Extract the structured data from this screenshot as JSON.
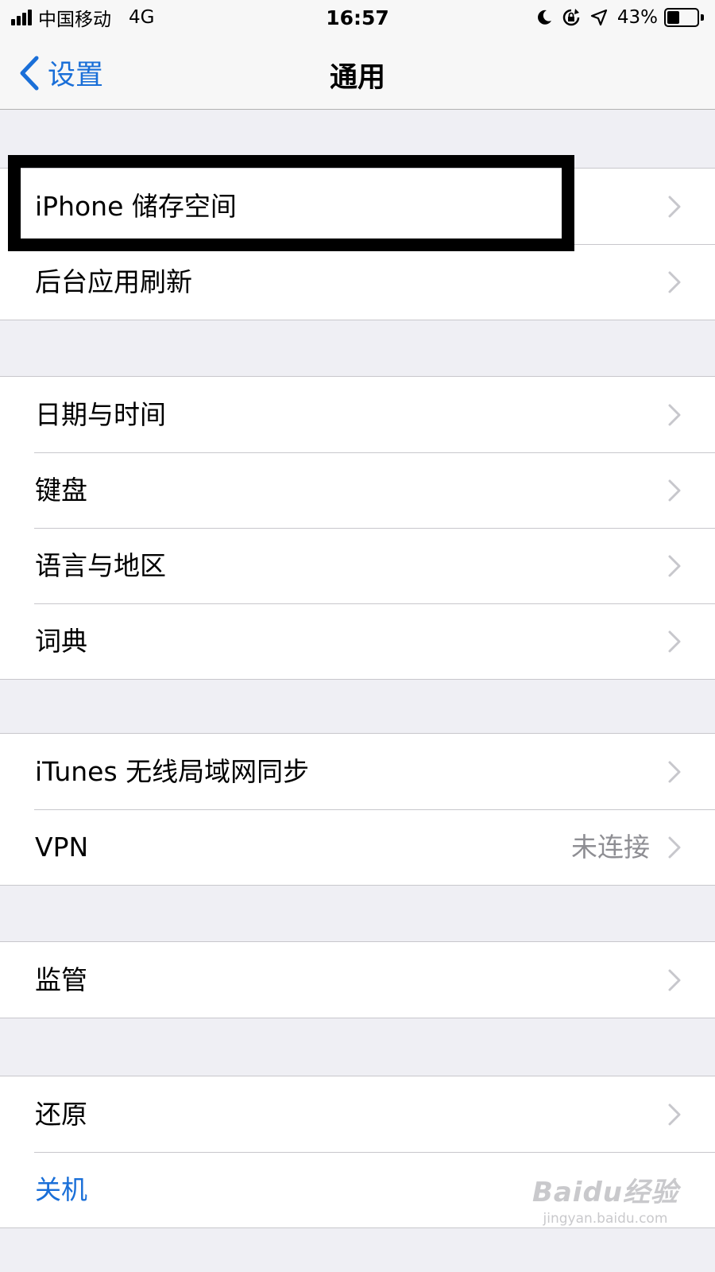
{
  "status_bar": {
    "carrier": "中国移动",
    "network": "4G",
    "time": "16:57",
    "battery_percent": "43%",
    "battery_level": 0.43,
    "icons": [
      "signal-icon",
      "moon-icon",
      "rotation-lock-icon",
      "location-icon",
      "battery-icon"
    ]
  },
  "nav": {
    "back_label": "设置",
    "title": "通用"
  },
  "groups": [
    {
      "rows": [
        {
          "label": "iPhone 储存空间"
        },
        {
          "label": "后台应用刷新"
        }
      ]
    },
    {
      "rows": [
        {
          "label": "日期与时间"
        },
        {
          "label": "键盘"
        },
        {
          "label": "语言与地区"
        },
        {
          "label": "词典"
        }
      ]
    },
    {
      "rows": [
        {
          "label": "iTunes 无线局域网同步"
        },
        {
          "label": "VPN",
          "value": "未连接"
        }
      ]
    },
    {
      "rows": [
        {
          "label": "监管"
        }
      ]
    },
    {
      "rows": [
        {
          "label": "还原"
        },
        {
          "label": "关机"
        }
      ]
    }
  ],
  "watermark": {
    "main": "Baidu经验",
    "sub": "jingyan.baidu.com"
  },
  "colors": {
    "accent": "#1a6fd8",
    "background": "#efeff4",
    "secondary_text": "#8e8e93",
    "chevron": "#c7c7cc"
  }
}
